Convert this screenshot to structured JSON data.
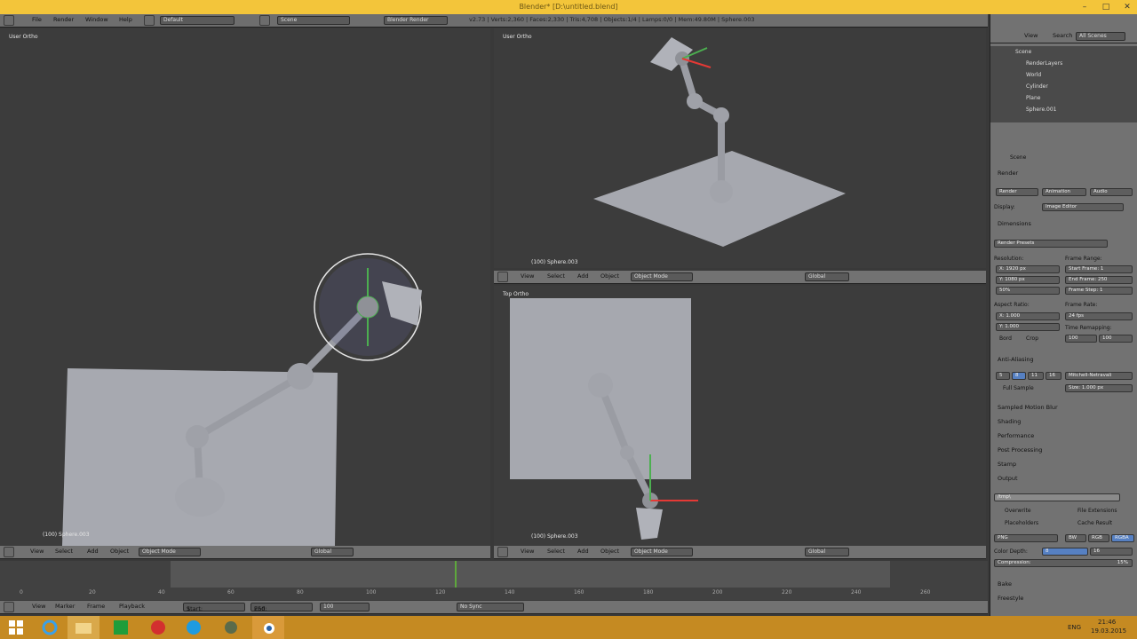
{
  "window": {
    "title": "Blender* [D:\\untitled.blend]"
  },
  "topbar": {
    "menus": [
      "File",
      "Render",
      "Window",
      "Help"
    ],
    "layout": "Default",
    "scene": "Scene",
    "engine": "Blender Render",
    "info": "v2.73 | Verts:2,360 | Faces:2,330 | Tris:4,708 | Objects:1/4 | Lamps:0/0 | Mem:49.80M | Sphere.003"
  },
  "viewports": {
    "left": {
      "label": "User Ortho",
      "object": "(100) Sphere.003"
    },
    "top_right": {
      "label": "User Ortho",
      "object": "(100) Sphere.003"
    },
    "bottom_right": {
      "label": "Top Ortho",
      "object": "(100) Sphere.003"
    }
  },
  "viewport_header": {
    "menus": [
      "View",
      "Select",
      "Add",
      "Object"
    ],
    "mode": "Object Mode",
    "orientation": "Global"
  },
  "outliner": {
    "menus": [
      "View",
      "Search",
      "All Scenes"
    ],
    "items": [
      "Scene",
      "RenderLayers",
      "World",
      "Cylinder",
      "Plane",
      "Sphere.001"
    ]
  },
  "properties": {
    "scene": "Scene",
    "render": {
      "title": "Render",
      "buttons": [
        "Render",
        "Animation",
        "Audio"
      ],
      "display_label": "Display:",
      "display_value": "Image Editor"
    },
    "dimensions": {
      "title": "Dimensions",
      "presets": "Render Presets",
      "resolution_label": "Resolution:",
      "x": "X: 1920 px",
      "y": "Y: 1080 px",
      "percent": "50%",
      "frame_range_label": "Frame Range:",
      "start": "Start Frame: 1",
      "end": "End Frame: 250",
      "step": "Frame Step: 1",
      "aspect_label": "Aspect Ratio:",
      "ax": "X: 1.000",
      "ay": "Y: 1.000",
      "frame_rate_label": "Frame Rate:",
      "fps": "24 fps",
      "time_remap": "Time Remapping:",
      "old": "100",
      "new": "100",
      "border": "Bord",
      "crop": "Crop"
    },
    "aa": {
      "title": "Anti-Aliasing",
      "samples": [
        "5",
        "8",
        "11",
        "16"
      ],
      "filter": "Mitchell-Netravali",
      "full_sample": "Full Sample",
      "size": "Size: 1.000 px"
    },
    "sections": [
      "Sampled Motion Blur",
      "Shading",
      "Performance",
      "Post Processing",
      "Stamp"
    ],
    "output": {
      "title": "Output",
      "path": "/tmp\\",
      "overwrite": "Overwrite",
      "extensions": "File Extensions",
      "placeholders": "Placeholders",
      "cache": "Cache Result",
      "format": "PNG",
      "bw": "BW",
      "rgb": "RGB",
      "rgba": "RGBA",
      "color_depth": "Color Depth:",
      "d8": "8",
      "d16": "16",
      "compression": "Compression:",
      "comp_val": "15%"
    },
    "more": [
      "Bake",
      "Freestyle"
    ]
  },
  "timeline": {
    "menus": [
      "View",
      "Marker",
      "Frame",
      "Playback"
    ],
    "start": "Start:",
    "start_val": "1",
    "end": "End:",
    "end_val": "250",
    "current": "100",
    "sync": "No Sync",
    "ticks": [
      "0",
      "20",
      "40",
      "60",
      "80",
      "100",
      "120",
      "140",
      "160",
      "180",
      "200",
      "220",
      "240",
      "260"
    ],
    "current_frame": 100
  },
  "taskbar": {
    "time": "21:46",
    "date": "19.03.2015",
    "lang": "ENG"
  }
}
